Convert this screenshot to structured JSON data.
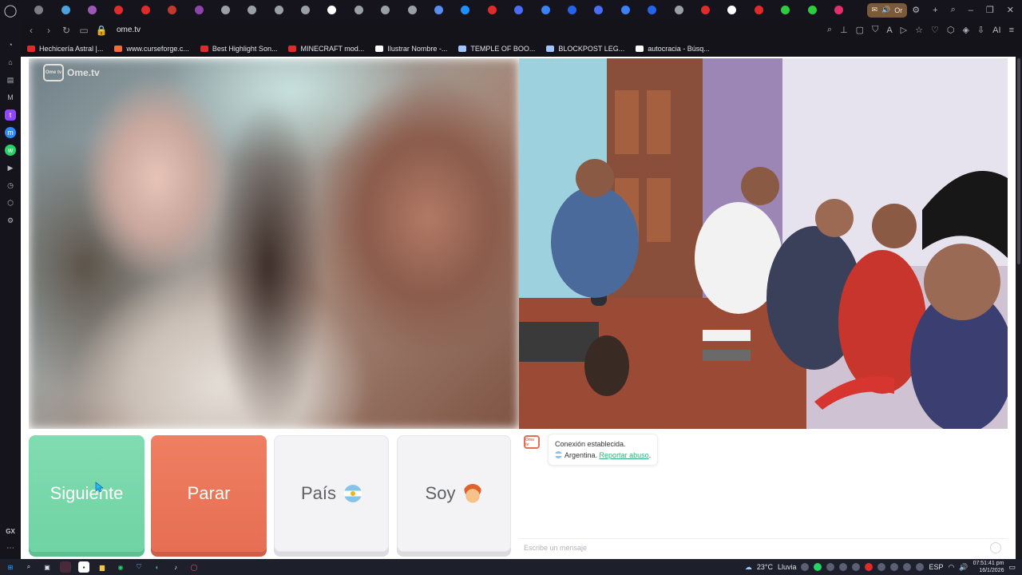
{
  "browser": {
    "url": "ome.tv",
    "active_tab_label": "Or",
    "ai_label": "AI",
    "tab_icon_colors": [
      "#7d7d8a",
      "#4aa3df",
      "#9b59b6",
      "#e02b2b",
      "#e02b2b",
      "#c0392b",
      "#8e44ad",
      "#9aa0a6",
      "#9aa0a6",
      "#9aa0a6",
      "#9aa0a6",
      "#ffffff",
      "#9aa0a6",
      "#9aa0a6",
      "#9aa0a6",
      "#5b8def",
      "#1e90ff",
      "#e02b2b",
      "#4a6cf7",
      "#3b82f6",
      "#2563eb",
      "#4a6cf7",
      "#3b82f6",
      "#2563eb",
      "#9aa0a6",
      "#e02b2b",
      "#ffffff",
      "#e02b2b",
      "#2ecc40",
      "#2ecc40",
      "#e1306c"
    ]
  },
  "bookmarks": [
    {
      "label": "Hechicería Astral |...",
      "color": "#e02b2b"
    },
    {
      "label": "www.curseforge.c...",
      "color": "#f26b3a"
    },
    {
      "label": "Best Highlight Son...",
      "color": "#e02b2b"
    },
    {
      "label": "MINECRAFT mod...",
      "color": "#e02b2b"
    },
    {
      "label": "Ilustrar Nombre -...",
      "color": "#ffffff"
    },
    {
      "label": "TEMPLE OF BOO...",
      "color": "#a0c4ff"
    },
    {
      "label": "BLOCKPOST LEG...",
      "color": "#a0c4ff"
    },
    {
      "label": "autocracia - Búsq...",
      "color": "#ffffff"
    }
  ],
  "sidebar": {
    "gx_label": "GX"
  },
  "omegle": {
    "logo_text": "Ome.tv",
    "logo_badge": "Ome tv",
    "buttons": {
      "next": "Siguiente",
      "stop": "Parar",
      "country": "País",
      "gender": "Soy"
    },
    "chat": {
      "icon_text": "Ome tv",
      "status": "Conexión establecida.",
      "country": "Argentina.",
      "report_link": "Reportar abuso",
      "report_suffix": ".",
      "input_placeholder": "Escribe un mensaje"
    }
  },
  "taskbar": {
    "weather_temp": "23°C",
    "weather_desc": "Lluvia",
    "lang": "ESP",
    "time": "07:51:41 pm",
    "date": "16/1/2026"
  }
}
